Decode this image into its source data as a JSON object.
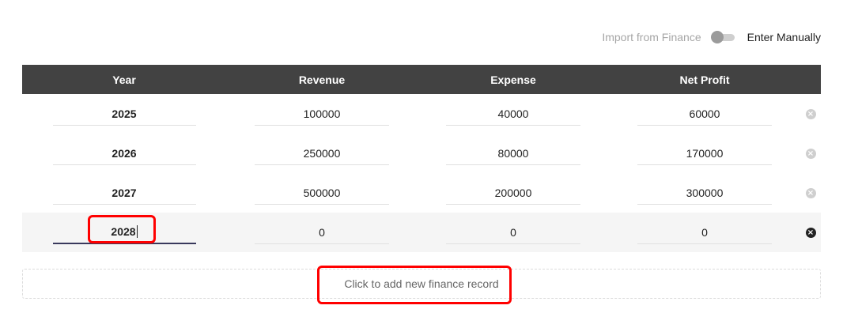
{
  "toggle": {
    "left_label": "Import from Finance",
    "right_label": "Enter Manually"
  },
  "table": {
    "headers": [
      "Year",
      "Revenue",
      "Expense",
      "Net Profit"
    ],
    "rows": [
      {
        "year": "2025",
        "revenue": "100000",
        "expense": "40000",
        "net_profit": "60000"
      },
      {
        "year": "2026",
        "revenue": "250000",
        "expense": "80000",
        "net_profit": "170000"
      },
      {
        "year": "2027",
        "revenue": "500000",
        "expense": "200000",
        "net_profit": "300000"
      },
      {
        "year": "2028",
        "revenue": "0",
        "expense": "0",
        "net_profit": "0"
      }
    ]
  },
  "add_button": {
    "label": "Click to add new finance record"
  },
  "icons": {
    "delete": "close-circle-icon"
  },
  "colors": {
    "header_bg": "#424242",
    "highlight": "#ff0000",
    "active_row_bg": "#f5f5f5"
  }
}
